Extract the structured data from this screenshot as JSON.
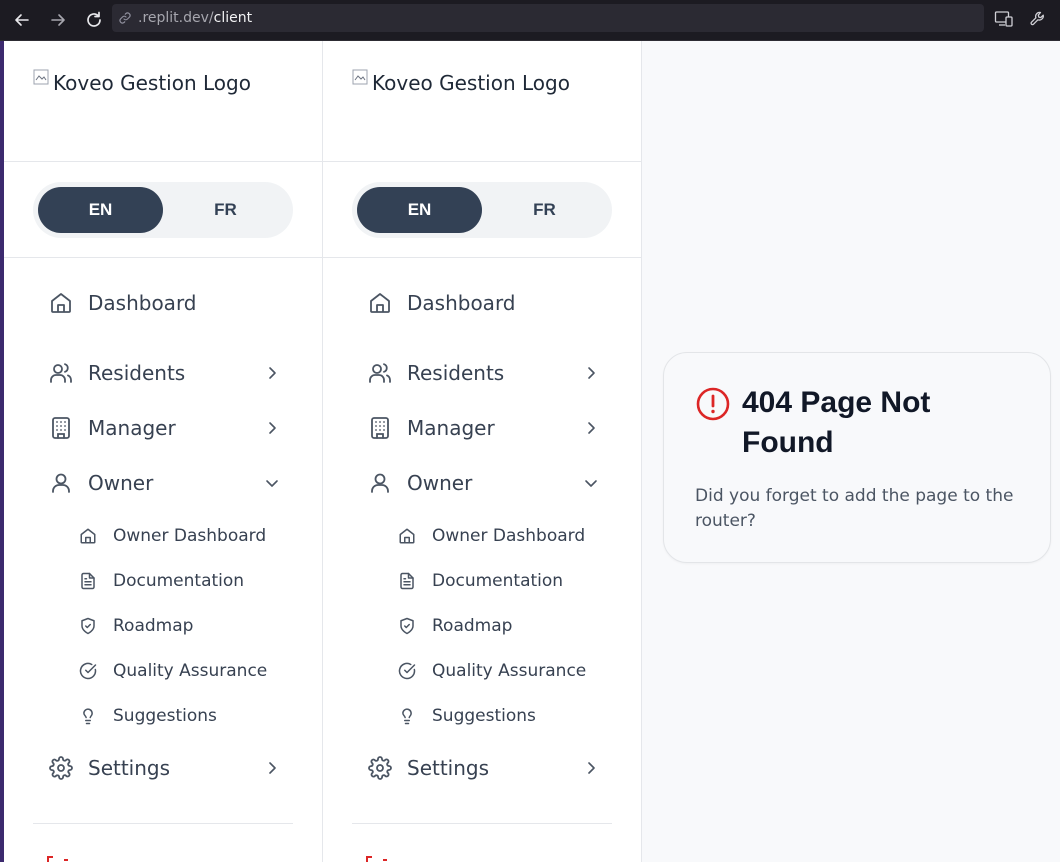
{
  "browser": {
    "url_host": ".replit.dev/",
    "url_path": "client"
  },
  "sidebar": {
    "logo_alt": "Koveo Gestion Logo",
    "lang": {
      "en": "EN",
      "fr": "FR",
      "selected": "EN"
    },
    "nav": {
      "dashboard": "Dashboard",
      "residents": "Residents",
      "manager": "Manager",
      "owner": "Owner",
      "settings": "Settings"
    },
    "owner_sub": {
      "owner_dashboard": "Owner Dashboard",
      "documentation": "Documentation",
      "roadmap": "Roadmap",
      "quality_assurance": "Quality Assurance",
      "suggestions": "Suggestions"
    }
  },
  "error_card": {
    "title": "404 Page Not Found",
    "description": "Did you forget to add the page to the router?"
  },
  "colors": {
    "accent": "#334155",
    "error": "#dc2626",
    "background": "#f8f9fb"
  }
}
